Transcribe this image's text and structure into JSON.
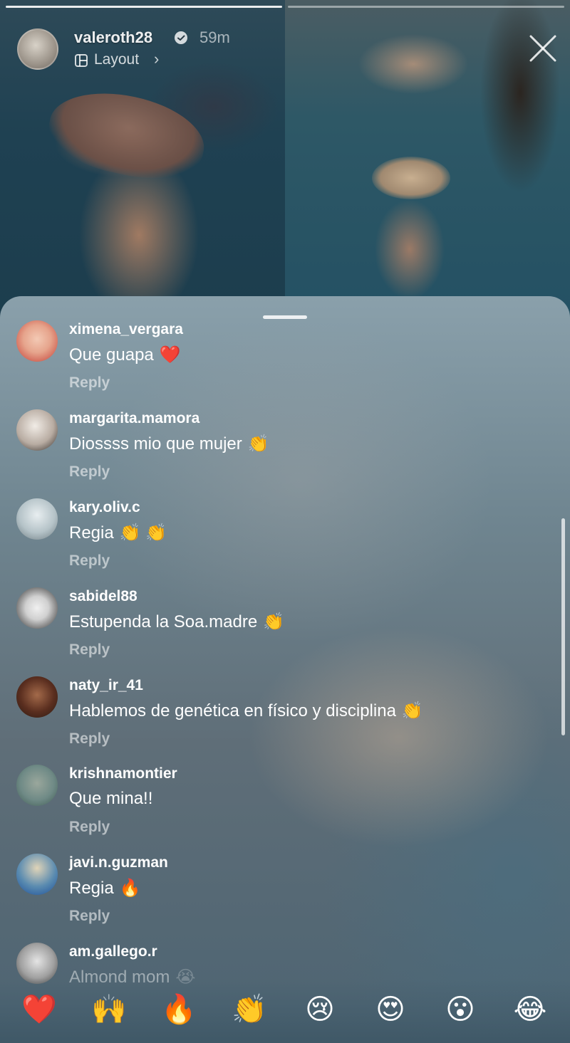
{
  "story": {
    "username": "valeroth28",
    "time_ago": "59m",
    "layout_label": "Layout",
    "layout_chevron": "›",
    "icons": {
      "verified": "verified-badge-icon",
      "layout": "layout-grid-icon",
      "close": "close-icon"
    }
  },
  "comments": [
    {
      "username": "ximena_vergara",
      "text": "Que guapa",
      "emoji": "❤️",
      "reply": "Reply"
    },
    {
      "username": "margarita.mamora",
      "text": "Diossss mio que mujer",
      "emoji": "👏",
      "reply": "Reply"
    },
    {
      "username": "kary.oliv.c",
      "text": "Regia",
      "emoji": "👏 👏",
      "reply": "Reply"
    },
    {
      "username": "sabidel88",
      "text": "Estupenda la Soa.madre",
      "emoji": "👏",
      "reply": "Reply"
    },
    {
      "username": "naty_ir_41",
      "text": "Hablemos de genética en físico y disciplina",
      "emoji": "👏",
      "reply": "Reply"
    },
    {
      "username": "krishnamontier",
      "text": "Que mina!!",
      "emoji": "",
      "reply": "Reply"
    },
    {
      "username": "javi.n.guzman",
      "text": "Regia",
      "emoji": "🔥",
      "reply": "Reply"
    },
    {
      "username": "am.gallego.r",
      "text": "Almond mom",
      "emoji": "😭",
      "reply": ""
    }
  ],
  "reactions": [
    "❤️",
    "🙌",
    "🔥",
    "👏",
    "😢",
    "😍",
    "😮",
    "😂"
  ],
  "colors": {
    "sheet_top": "#8aa0ab",
    "sheet_bottom": "#4d6472",
    "reply_text": "rgba(255,255,255,0.55)"
  }
}
